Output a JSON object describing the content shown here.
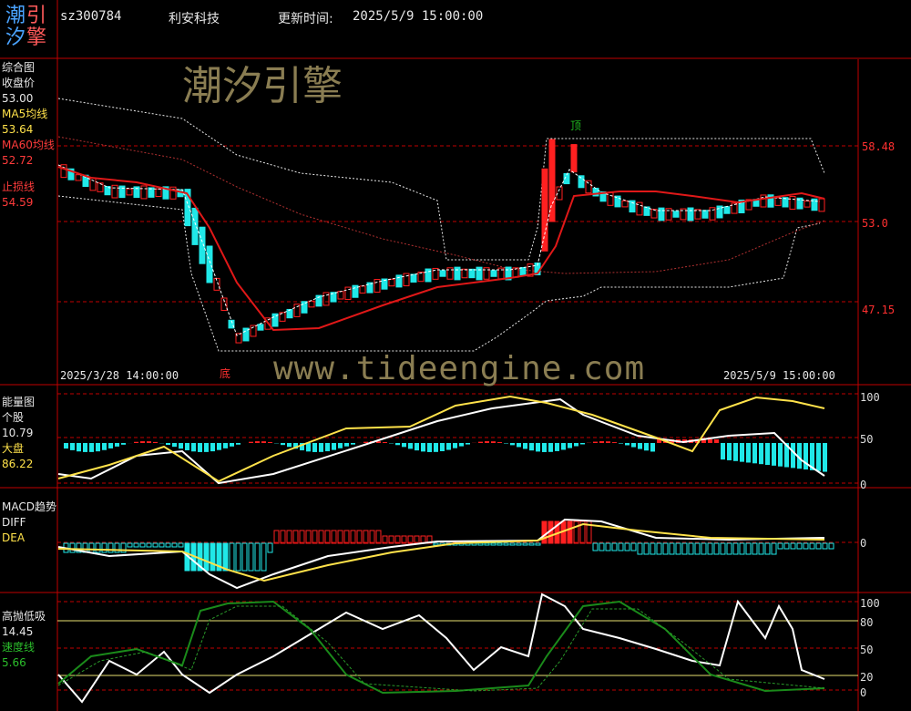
{
  "header": {
    "logo": [
      "潮",
      "引",
      "汐",
      "擎"
    ],
    "code": "sz300784",
    "name": "利安科技",
    "update_label": "更新时间:",
    "update_time": "2025/5/9 15:00:00"
  },
  "watermark": {
    "brand": "潮汐引擎",
    "url": "www.tideengine.com"
  },
  "main_panel": {
    "title": "综合图",
    "close_label": "收盘价",
    "close_value": "53.00",
    "ma5_label": "MA5均线",
    "ma5_value": "53.64",
    "ma60_label": "MA60均线",
    "ma60_value": "52.72",
    "stop_label": "止损线",
    "stop_value": "54.59",
    "date_left": "2025/3/28 14:00:00",
    "date_right": "2025/5/9 15:00:00",
    "top_mark": "顶",
    "bottom_mark": "底",
    "y_ticks": [
      "58.48",
      "53.0",
      "47.15"
    ]
  },
  "energy_panel": {
    "title": "能量图",
    "stock_label": "个股",
    "stock_value": "10.79",
    "market_label": "大盘",
    "market_value": "86.22",
    "y_ticks": [
      "100",
      "50",
      "0"
    ]
  },
  "macd_panel": {
    "title": "MACD趋势",
    "diff_label": "DIFF",
    "dea_label": "DEA",
    "y_ticks": [
      "0"
    ]
  },
  "swing_panel": {
    "title": "高抛低吸",
    "value": "14.45",
    "speed_label": "速度线",
    "speed_value": "5.66",
    "y_ticks": [
      "100",
      "80",
      "50",
      "20",
      "0"
    ]
  },
  "colors": {
    "up": "#ff2020",
    "down": "#20e8e8",
    "ma60": "#e01818",
    "band": "#e8e8e8",
    "yellow": "#ffe24a",
    "white": "#ffffff",
    "green": "#1a8a1a",
    "axis": "#c00000"
  }
}
